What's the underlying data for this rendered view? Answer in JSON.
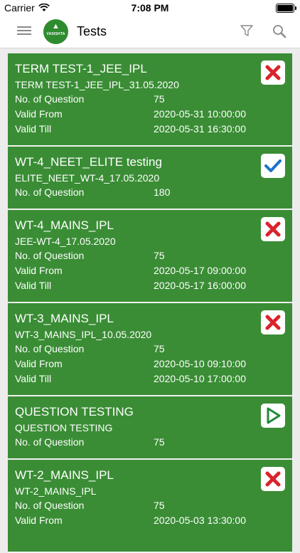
{
  "status_bar": {
    "carrier": "Carrier",
    "time": "7:08 PM"
  },
  "header": {
    "title": "Tests",
    "logo_text": "VASISHTA"
  },
  "labels": {
    "questions": "No. of Question",
    "valid_from": "Valid From",
    "valid_till": "Valid Till"
  },
  "tests": [
    {
      "title": "TERM TEST-1_JEE_IPL",
      "code": "TERM TEST-1_JEE_IPL_31.05.2020",
      "questions": "75",
      "valid_from": "2020-05-31 10:00:00",
      "valid_till": "2020-05-31 16:30:00",
      "status_icon": "cross-icon"
    },
    {
      "title": "WT-4_NEET_ELITE testing",
      "code": "ELITE_NEET_WT-4_17.05.2020",
      "questions": "180",
      "status_icon": "check-icon"
    },
    {
      "title": "WT-4_MAINS_IPL",
      "code": "JEE-WT-4_17.05.2020",
      "questions": "75",
      "valid_from": "2020-05-17 09:00:00",
      "valid_till": "2020-05-17 16:00:00",
      "status_icon": "cross-icon"
    },
    {
      "title": "WT-3_MAINS_IPL",
      "code": "WT-3_MAINS_IPL_10.05.2020",
      "questions": "75",
      "valid_from": "2020-05-10 09:10:00",
      "valid_till": "2020-05-10 17:00:00",
      "status_icon": "cross-icon"
    },
    {
      "title": "QUESTION TESTING",
      "code": "QUESTION TESTING",
      "questions": "75",
      "status_icon": "play-icon"
    },
    {
      "title": "WT-2_MAINS_IPL",
      "code": "WT-2_MAINS_IPL",
      "questions": "75",
      "valid_from": "2020-05-03 13:30:00",
      "status_icon": "cross-icon"
    }
  ],
  "colors": {
    "card_green": "#3a8d35",
    "cross_red": "#d9242b",
    "check_blue": "#1a73c9",
    "play_green": "#1f8a3a"
  }
}
